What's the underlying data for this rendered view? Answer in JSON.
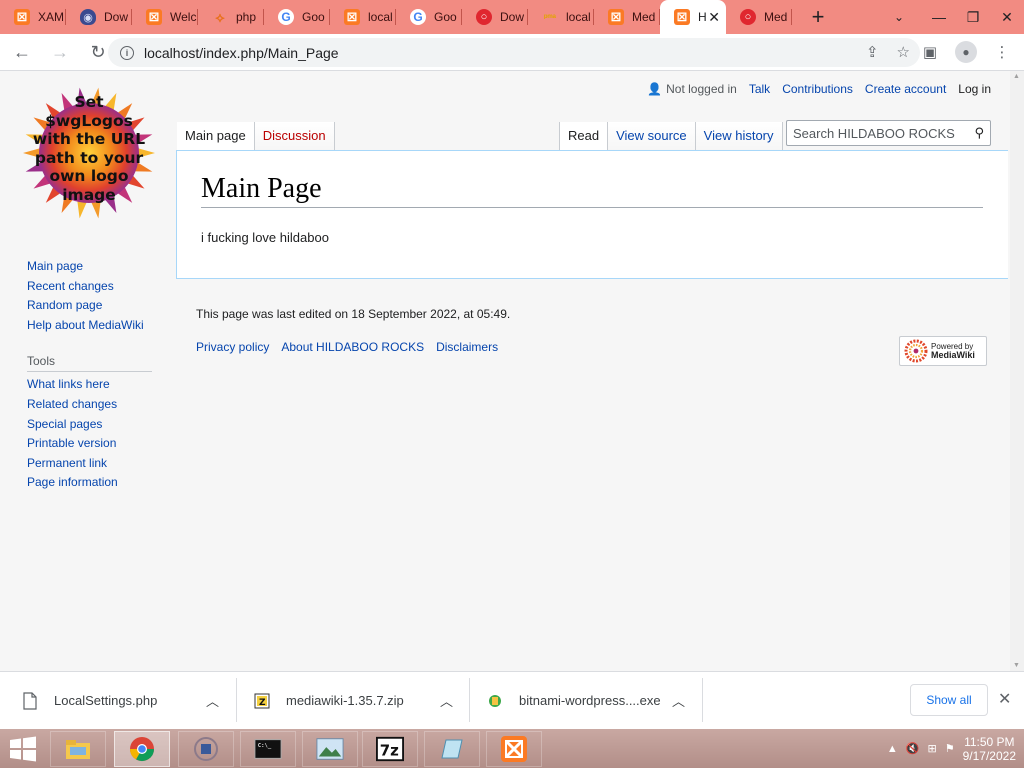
{
  "browser": {
    "tabs": [
      {
        "icon": "xampp-icon",
        "label": "XAM"
      },
      {
        "icon": "shield-icon",
        "label": "Dow"
      },
      {
        "icon": "xampp-icon",
        "label": "Welc"
      },
      {
        "icon": "php-icon",
        "label": "php"
      },
      {
        "icon": "google-icon",
        "label": "Goo"
      },
      {
        "icon": "xampp-icon",
        "label": "local"
      },
      {
        "icon": "google-icon",
        "label": "Goo"
      },
      {
        "icon": "opera-icon",
        "label": "Dow"
      },
      {
        "icon": "phpmyadmin-icon",
        "label": "local"
      },
      {
        "icon": "xampp-icon",
        "label": "Med"
      },
      {
        "icon": "xampp-icon",
        "label": "H"
      },
      {
        "icon": "opera-icon",
        "label": "Med"
      }
    ],
    "active_tab_index": 10,
    "url": "localhost/index.php/Main_Page"
  },
  "wiki": {
    "logo_text": [
      "Set",
      "$wgLogos",
      "with the URL",
      "path to your",
      "own logo",
      "image"
    ],
    "personal": {
      "not_logged_in": "Not logged in",
      "talk": "Talk",
      "contributions": "Contributions",
      "create_account": "Create account",
      "log_in": "Log in"
    },
    "tabs_left": {
      "main_page": "Main page",
      "discussion": "Discussion"
    },
    "tabs_right": {
      "read": "Read",
      "view_source": "View source",
      "view_history": "View history"
    },
    "search_placeholder": "Search HILDABOO ROCKS",
    "page_title": "Main Page",
    "page_body": "i fucking love hildaboo",
    "sidebar": {
      "navigation": [
        "Main page",
        "Recent changes",
        "Random page",
        "Help about MediaWiki"
      ],
      "tools_heading": "Tools",
      "tools": [
        "What links here",
        "Related changes",
        "Special pages",
        "Printable version",
        "Permanent link",
        "Page information"
      ]
    },
    "footer": {
      "last_edited": "This page was last edited on 18 September 2022, at 05:49.",
      "links": [
        "Privacy policy",
        "About HILDABOO ROCKS",
        "Disclaimers"
      ],
      "powered_by": "Powered by",
      "powered_name": "MediaWiki"
    }
  },
  "downloads": {
    "items": [
      "LocalSettings.php",
      "mediawiki-1.35.7.zip",
      "bitnami-wordpress....exe"
    ],
    "show_all": "Show all"
  },
  "taskbar": {
    "time": "11:50 PM",
    "date": "9/17/2022"
  },
  "colors": {
    "tabstrip": "#f28b82",
    "link": "#0645ad",
    "red_link": "#ba0000",
    "content_border": "#a7d7f9"
  }
}
